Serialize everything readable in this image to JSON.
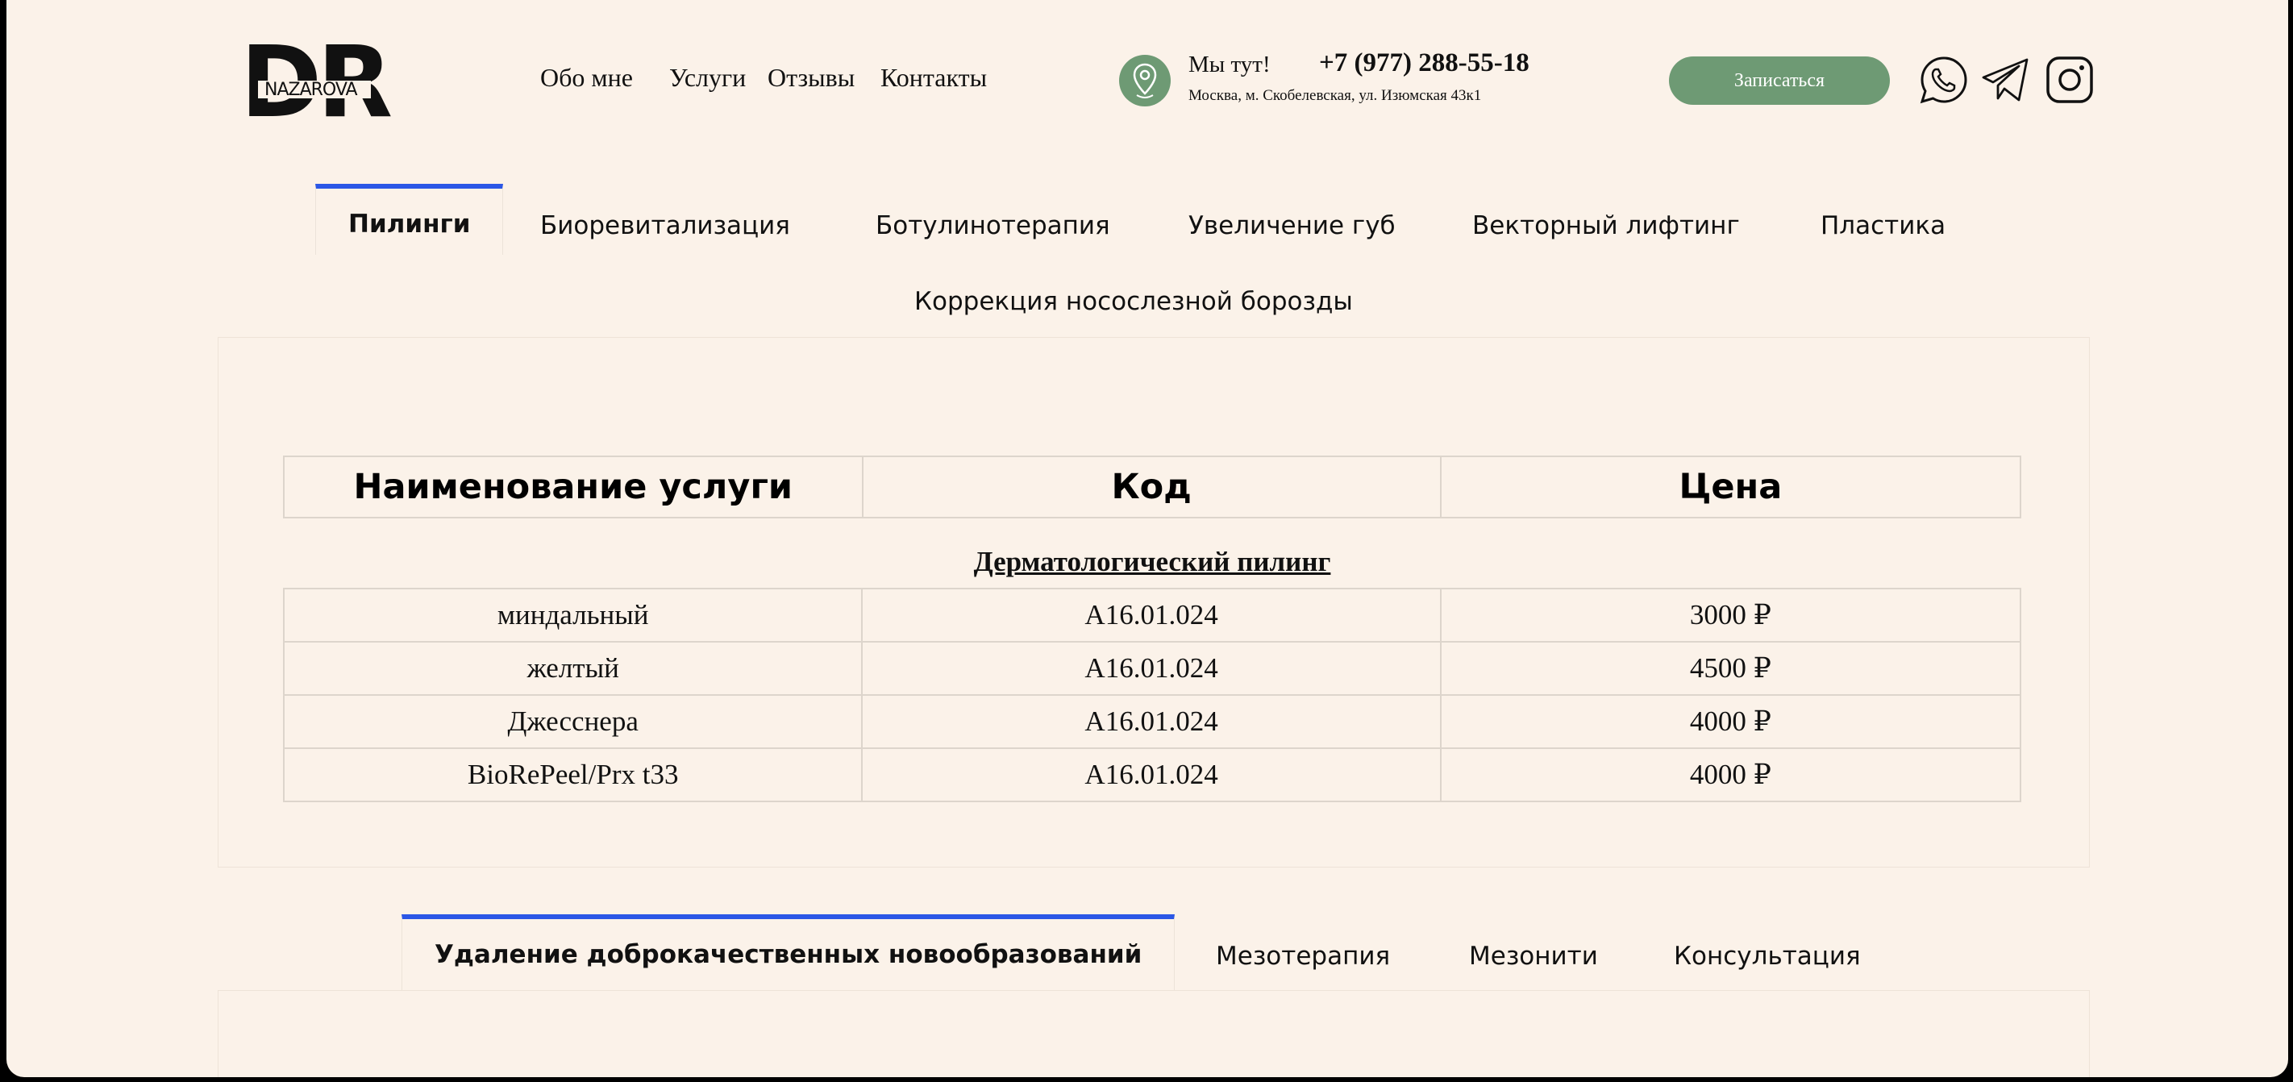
{
  "header": {
    "logo": {
      "letters": "DR",
      "name": "NAZAROVA"
    },
    "nav": [
      "Обо мне",
      "Услуги",
      "Отзывы",
      "Контакты"
    ],
    "location_label": "Мы тут!",
    "phone": "+7 (977) 288-55-18",
    "address": "Москва, м. Скобелевская, ул. Изюмская 43к1",
    "book_button": "Записаться",
    "social_icons": [
      "whatsapp-icon",
      "telegram-icon",
      "instagram-icon"
    ]
  },
  "tabs_top": {
    "items": [
      "Пилинги",
      "Биоревитализация",
      "Ботулинотерапия",
      "Увеличение губ",
      "Векторный лифтинг",
      "Пластика",
      "Коррекция носослезной борозды"
    ],
    "active": "Пилинги"
  },
  "table": {
    "headers": [
      "Наименование услуги",
      "Код",
      "Цена"
    ],
    "section_title": "Дерматологический пилинг",
    "rows": [
      [
        "миндальный",
        "A16.01.024",
        "3000 ₽"
      ],
      [
        "желтый",
        "A16.01.024",
        "4500 ₽"
      ],
      [
        "Джесснера",
        "A16.01.024",
        "4000 ₽"
      ],
      [
        "BioRePeel/Prx t33",
        "A16.01.024",
        "4000 ₽"
      ]
    ]
  },
  "tabs_bottom": {
    "items": [
      "Удаление доброкачественных новообразований",
      "Мезотерапия",
      "Мезонити",
      "Консультация"
    ],
    "active": "Удаление доброкачественных новообразований"
  },
  "colors": {
    "background": "#fbf2e9",
    "accent_green": "#6e9a74",
    "tab_indicator": "#2b57e6"
  }
}
